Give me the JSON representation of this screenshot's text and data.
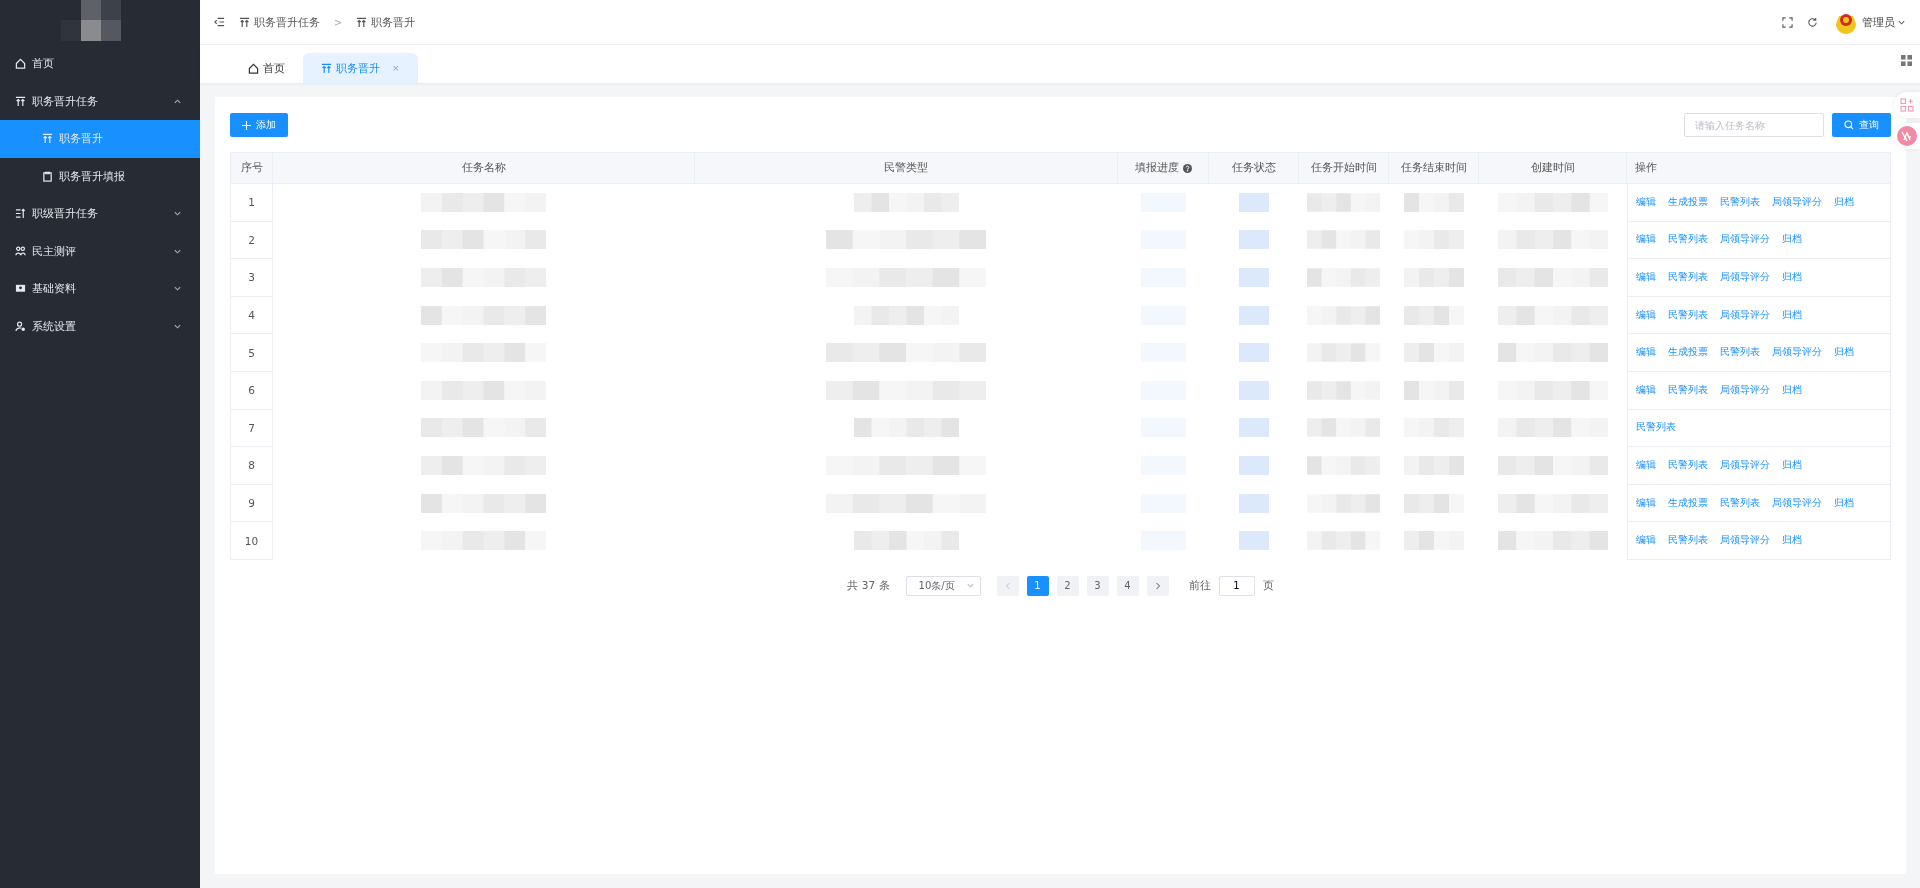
{
  "sidebar": {
    "items": [
      {
        "label": "首页",
        "selected": false
      },
      {
        "label": "职务晋升任务",
        "expanded": true,
        "selected": false,
        "children": [
          {
            "label": "职务晋升",
            "selected": true
          },
          {
            "label": "职务晋升填报",
            "selected": false
          }
        ]
      },
      {
        "label": "职级晋升任务",
        "expanded": false,
        "selected": false
      },
      {
        "label": "民主测评",
        "expanded": false,
        "selected": false
      },
      {
        "label": "基础资料",
        "expanded": false,
        "selected": false
      },
      {
        "label": "系统设置",
        "expanded": false,
        "selected": false
      }
    ]
  },
  "breadcrumb": {
    "items": [
      "职务晋升任务",
      "职务晋升"
    ],
    "separator": ">"
  },
  "user": {
    "name": "管理员"
  },
  "tabs": [
    {
      "label": "首页",
      "selected": false
    },
    {
      "label": "职务晋升",
      "selected": true,
      "close": "×"
    }
  ],
  "toolbar": {
    "add_button": "添加",
    "search": {
      "placeholder": "请输入任务名称"
    },
    "query_button": "查询"
  },
  "table": {
    "columns": [
      "序号",
      "任务名称",
      "民警类型",
      "填报进度",
      "任务状态",
      "任务开始时间",
      "任务结束时间",
      "创建时间",
      "操作"
    ],
    "rows": [
      {
        "index": "1",
        "actions": [
          "编辑",
          "生成投票",
          "民警列表",
          "局领导评分",
          "归档"
        ]
      },
      {
        "index": "2",
        "actions": [
          "编辑",
          "民警列表",
          "局领导评分",
          "归档"
        ]
      },
      {
        "index": "3",
        "actions": [
          "编辑",
          "民警列表",
          "局领导评分",
          "归档"
        ]
      },
      {
        "index": "4",
        "actions": [
          "编辑",
          "民警列表",
          "局领导评分",
          "归档"
        ]
      },
      {
        "index": "5",
        "actions": [
          "编辑",
          "生成投票",
          "民警列表",
          "局领导评分",
          "归档"
        ]
      },
      {
        "index": "6",
        "actions": [
          "编辑",
          "民警列表",
          "局领导评分",
          "归档"
        ]
      },
      {
        "index": "7",
        "actions": [
          "民警列表"
        ]
      },
      {
        "index": "8",
        "actions": [
          "编辑",
          "民警列表",
          "局领导评分",
          "归档"
        ]
      },
      {
        "index": "9",
        "actions": [
          "编辑",
          "生成投票",
          "民警列表",
          "局领导评分",
          "归档"
        ]
      },
      {
        "index": "10",
        "actions": [
          "编辑",
          "民警列表",
          "局领导评分",
          "归档"
        ]
      }
    ]
  },
  "pagination": {
    "total": "共 37 条",
    "page_size": "10条/页",
    "pages": [
      {
        "label": "1",
        "selected": true
      },
      {
        "label": "2",
        "selected": false
      },
      {
        "label": "3",
        "selected": false
      },
      {
        "label": "4",
        "selected": false
      }
    ],
    "goto_label": "前往",
    "goto_value": "1",
    "goto_suffix": "页"
  }
}
